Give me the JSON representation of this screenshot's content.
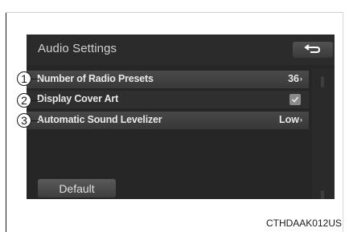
{
  "screen": {
    "title": "Audio Settings",
    "back_icon": "return-arrow-icon",
    "items": [
      {
        "label": "Number of Radio Presets",
        "value": "36",
        "chevron": "›"
      },
      {
        "label": "Display Cover Art",
        "checked": true
      },
      {
        "label": "Automatic Sound Levelizer",
        "value": "Low",
        "chevron": "›"
      }
    ],
    "default_label": "Default"
  },
  "callouts": [
    "1",
    "2",
    "3"
  ],
  "caption": "CTHDAAK012US",
  "colors": {
    "screen_bg": "#262626",
    "row_highlight": "#444444",
    "text": "#e8e8e8"
  }
}
